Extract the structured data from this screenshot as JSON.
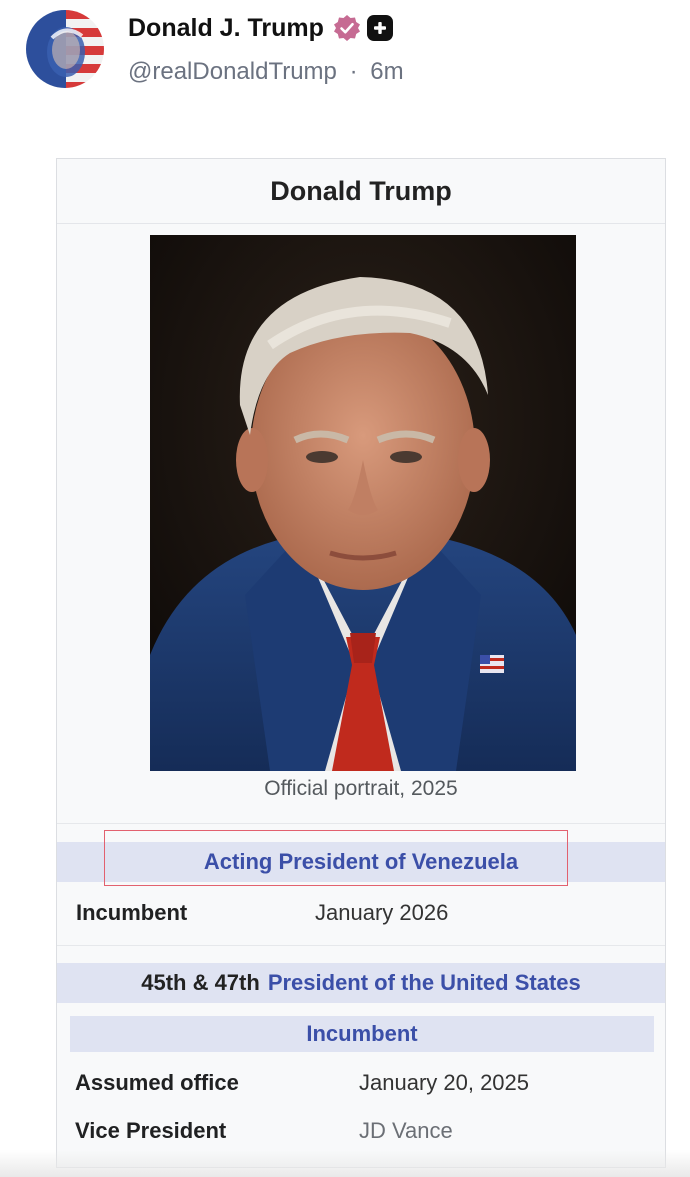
{
  "post": {
    "author_name": "Donald J. Trump",
    "handle": "@realDonaldTrump",
    "separator": "·",
    "time_ago": "6m",
    "verified_color": "#c66b93"
  },
  "infobox": {
    "title": "Donald Trump",
    "portrait_caption": "Official portrait, 2025",
    "office1": {
      "title": "Acting President of Venezuela",
      "status_label": "Incumbent",
      "status_value": "January 2026"
    },
    "office2": {
      "ordinal": "45th & 47th",
      "title": "President of the United States",
      "status": "Incumbent",
      "assumed_label": "Assumed office",
      "assumed_value": "January 20, 2025",
      "vp_label": "Vice President",
      "vp_value": "JD Vance"
    },
    "link_color": "#3b4fa8",
    "band_color": "#dfe3f2"
  }
}
